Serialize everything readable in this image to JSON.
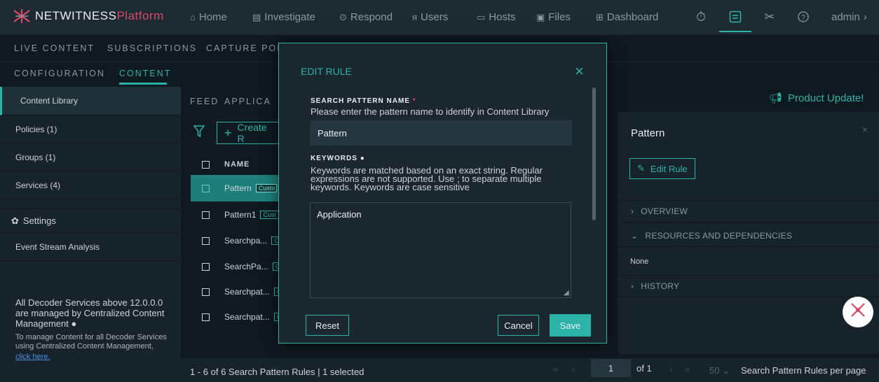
{
  "app": {
    "brand": "NETWITNESS",
    "brand_suffix": "Platform",
    "user": "admin"
  },
  "topnav": {
    "items": [
      {
        "label": "Home",
        "icon": "home-icon"
      },
      {
        "label": "Investigate",
        "icon": "investigate-icon"
      },
      {
        "label": "Respond",
        "icon": "respond-icon"
      },
      {
        "label": "Users",
        "icon": "users-icon"
      },
      {
        "label": "Hosts",
        "icon": "hosts-icon"
      },
      {
        "label": "Files",
        "icon": "files-icon"
      },
      {
        "label": "Dashboard",
        "icon": "dashboard-icon"
      }
    ],
    "tools": [
      "timer-icon",
      "admin-panel-icon",
      "tools-icon",
      "help-icon"
    ]
  },
  "subnav1": [
    "LIVE CONTENT",
    "SUBSCRIPTIONS",
    "CAPTURE POLI"
  ],
  "subnav2": [
    "CONFIGURATION",
    "CONTENT"
  ],
  "sidebar": {
    "items": [
      "Content Library",
      "Policies (1)",
      "Groups (1)",
      "Services (4)"
    ],
    "settings": "Settings",
    "event_stream": "Event Stream Analysis",
    "note": "All Decoder Services above 12.0.0.0 are managed by Centralized Content Management",
    "small": "To manage Content for all Decoder Services using Centralized Content Management,",
    "link": "click here."
  },
  "content": {
    "tabs": [
      "FEED",
      "APPLICA"
    ],
    "create_button": "Create R",
    "column_name": "NAME",
    "rows": [
      {
        "name": "Pattern",
        "tag": "Custo",
        "selected": true
      },
      {
        "name": "Pattern1",
        "tag": "Cust",
        "selected": false
      },
      {
        "name": "Searchpa...",
        "tag": "C",
        "selected": false
      },
      {
        "name": "SearchPa...",
        "tag": "C",
        "selected": false
      },
      {
        "name": "Searchpat...",
        "tag": "C",
        "selected": false
      },
      {
        "name": "Searchpat...",
        "tag": "C",
        "selected": false
      }
    ],
    "product_update": "Product Update!"
  },
  "right_panel": {
    "title": "Pattern",
    "edit_rule": "Edit Rule",
    "overview": "OVERVIEW",
    "resources": "RESOURCES AND DEPENDENCIES",
    "none": "None",
    "history": "HISTORY"
  },
  "footer": {
    "summary": "1 - 6 of 6 Search Pattern Rules | 1 selected",
    "page": "1",
    "of_label": "of",
    "total_pages": "1",
    "per_page": "50",
    "per_page_label": "Search Pattern Rules per page"
  },
  "modal": {
    "title": "EDIT RULE",
    "name_label": "SEARCH PATTERN NAME",
    "required_mark": "*",
    "name_help": "Please enter the pattern name to identify in Content Library",
    "name_value": "Pattern",
    "keywords_label": "KEYWORDS",
    "keywords_help_1": "Keywords are matched based on an exact string. Regular",
    "keywords_help_2": "expressions are not supported. Use ; to separate multiple",
    "keywords_help_3": "keywords. Keywords are case sensitive",
    "keywords_value": "Application",
    "reset": "Reset",
    "cancel": "Cancel",
    "save": "Save"
  },
  "colors": {
    "accent": "#2bb3a8",
    "brand_pink": "#d64a6a",
    "link": "#4a8fe0"
  }
}
